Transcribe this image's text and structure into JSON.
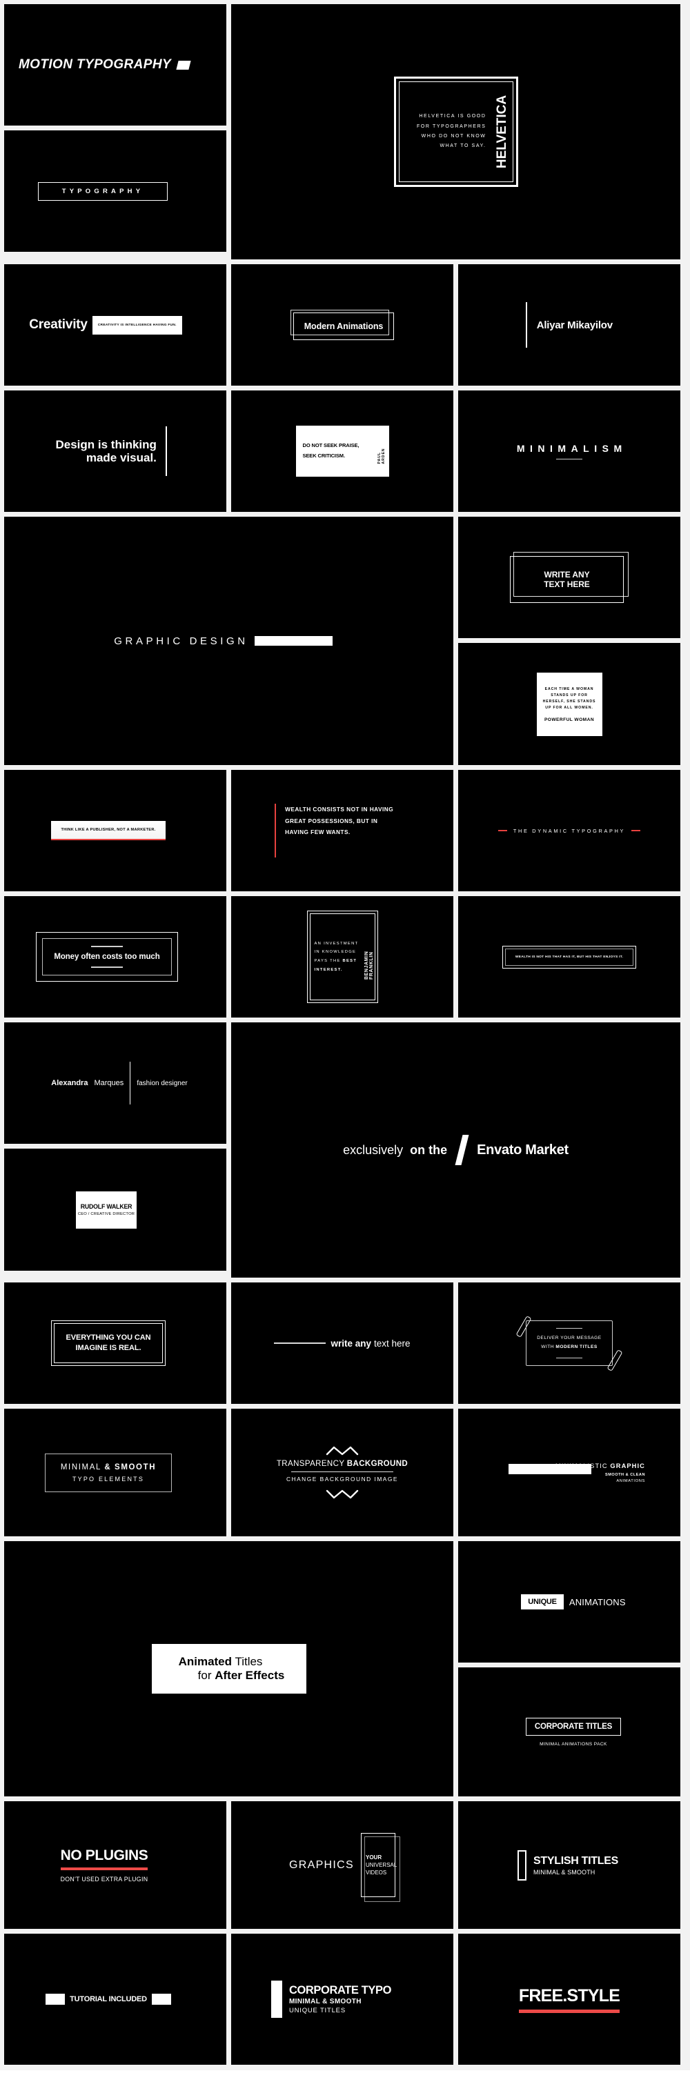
{
  "theme": {
    "background": "#000000",
    "foreground": "#ffffff",
    "sheet_background": "#f2f2f2",
    "accent_red": "#ed4a48"
  },
  "panels": {
    "motion_typography": {
      "title": "MOTION TYPOGRAPHY"
    },
    "typography_box": {
      "title": "TYPOGRAPHY"
    },
    "helvetica": {
      "quote_lines": [
        "HELVETICA IS GOOD",
        "FOR TYPOGRAPHERS",
        "WHO DO NOT KNOW",
        "WHAT TO SAY."
      ],
      "vertical_word": "HELVETICA"
    },
    "creativity": {
      "title": "Creativity",
      "tag": "CREATIVITY IS INTELLIGENCE HAVING FUN."
    },
    "modern_animations": {
      "title": "Modern Animations"
    },
    "aliyar": {
      "name": "Aliyar Mikayilov"
    },
    "design_thinking": {
      "line1": "Design is thinking",
      "line2": "made visual."
    },
    "paul_arden": {
      "line1": "DO NOT SEEK PRAISE,",
      "line2": "SEEK CRITICISM.",
      "author": "PAUL ARDEN"
    },
    "minimalism": {
      "title": "MINIMALISM"
    },
    "graphic_design": {
      "title": "GRAPHIC DESIGN"
    },
    "write_any_text": {
      "line1": "WRITE ANY",
      "line2": "TEXT HERE"
    },
    "powerful_woman": {
      "quote_part1": "EACH TIME A ",
      "quote_bold": "WOMAN STANDS",
      "quote_part2": " UP FOR HERSELF, SHE STANDS UP FOR ALL WOMEN.",
      "name": "POWERFUL WOMAN"
    },
    "think_like_publisher": {
      "text": "THINK LIKE A PUBLISHER, NOT A MARKETER."
    },
    "wealth_consists": {
      "line1": "WEALTH CONSISTS NOT IN HAVING",
      "line2": "GREAT POSSESSIONS, BUT IN",
      "line3": "HAVING FEW WANTS."
    },
    "dynamic_typography": {
      "title": "THE DYNAMIC TYPOGRAPHY"
    },
    "money_costs": {
      "title": "Money often costs too much"
    },
    "benjamin_franklin": {
      "quote_normal": "AN INVESTMENT IN KNOWLEDGE PAYS THE ",
      "quote_bold": "BEST INTEREST.",
      "author": "BENJAMIN FRANKLIN"
    },
    "wealth_enjoys": {
      "text": "WEALTH IS NOT HIS THAT HAS IT, BUT HIS THAT ENJOYS IT."
    },
    "alexandra": {
      "first_name": "Alexandra",
      "last_name": "Marques",
      "role": "fashion designer"
    },
    "rudolf_walker": {
      "name": "RUDOLF WALKER",
      "role": "CEO / CREATIVE DIRECTOR"
    },
    "envato": {
      "word1": "exclusively",
      "word2": "on the",
      "word3": "Envato Market"
    },
    "everything_imagine": {
      "line1": "EVERYTHING YOU CAN",
      "line2": "IMAGINE IS REAL."
    },
    "write_any_text_here": {
      "bold": "write any",
      "normal": "text here"
    },
    "deliver_message": {
      "line1": "DELIVER YOUR MESSAGE",
      "line2_normal": "WITH ",
      "line2_bold": "MODERN TITLES"
    },
    "minimal_smooth": {
      "title_normal": "MINIMAL ",
      "title_bold": "& SMOOTH",
      "subtitle": "TYPO ELEMENTS"
    },
    "transparency": {
      "title_normal": "TRANSPARENCY ",
      "title_bold": "BACKGROUND",
      "subtitle": "CHANGE BACKGROUND IMAGE"
    },
    "minimalistic_graphic": {
      "line1_normal": "MINIMALISTIC ",
      "line1_bold": "GRAPHIC",
      "line2": "SMOOTH & CLEAN",
      "line3": "ANIMATIONS"
    },
    "animated_titles": {
      "l1_bold": "Animated",
      "l1_normal": " Titles",
      "l2_normal": "for ",
      "l2_bold": "After Effects"
    },
    "unique_animations": {
      "badge": "UNIQUE",
      "title": "ANIMATIONS"
    },
    "corporate_titles": {
      "title": "CORPORATE TITLES",
      "subtitle": "MINIMAL ANIMATIONS PACK"
    },
    "no_plugins": {
      "title": "NO PLUGINS",
      "subtitle": "DON'T USED EXTRA PLUGIN"
    },
    "graphics": {
      "title": "GRAPHICS",
      "line1": "YOUR",
      "line2": "UNIVERSAL",
      "line3": "VIDEOS"
    },
    "stylish_titles": {
      "title": "STYLISH TITLES",
      "subtitle": "MINIMAL & SMOOTH"
    },
    "tutorial_included": {
      "title": "TUTORIAL INCLUDED"
    },
    "corporate_typo": {
      "title": "CORPORATE TYPO",
      "subtitle": "MINIMAL & SMOOTH",
      "tagline": "UNIQUE TITLES"
    },
    "free_style": {
      "title": "FREE.STYLE"
    }
  }
}
